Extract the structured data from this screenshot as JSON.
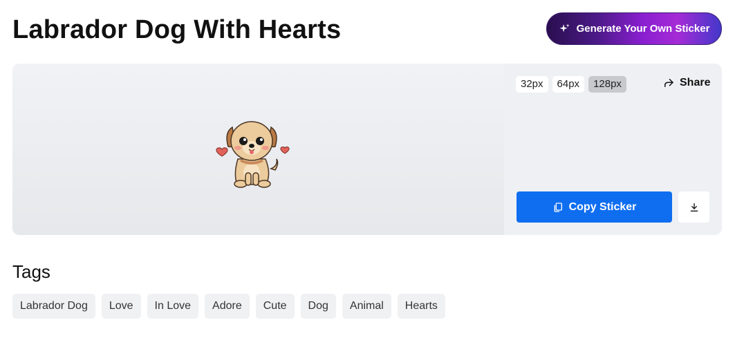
{
  "page": {
    "title": "Labrador Dog With Hearts"
  },
  "header": {
    "generate_label": "Generate Your Own Sticker",
    "generate_icon": "sparkle-icon"
  },
  "controls": {
    "sizes": [
      {
        "label": "32px",
        "active": false
      },
      {
        "label": "64px",
        "active": false
      },
      {
        "label": "128px",
        "active": true
      }
    ],
    "share_label": "Share",
    "share_icon": "share-icon",
    "copy_label": "Copy Sticker",
    "copy_icon": "copy-icon",
    "download_icon": "download-icon"
  },
  "tags": {
    "heading": "Tags",
    "items": [
      "Labrador Dog",
      "Love",
      "In Love",
      "Adore",
      "Cute",
      "Dog",
      "Animal",
      "Hearts"
    ]
  },
  "colors": {
    "primary": "#0f6ef0",
    "gradient_start": "#2a0e4f",
    "gradient_mid": "#a52bd6",
    "gradient_end": "#4338ca"
  }
}
